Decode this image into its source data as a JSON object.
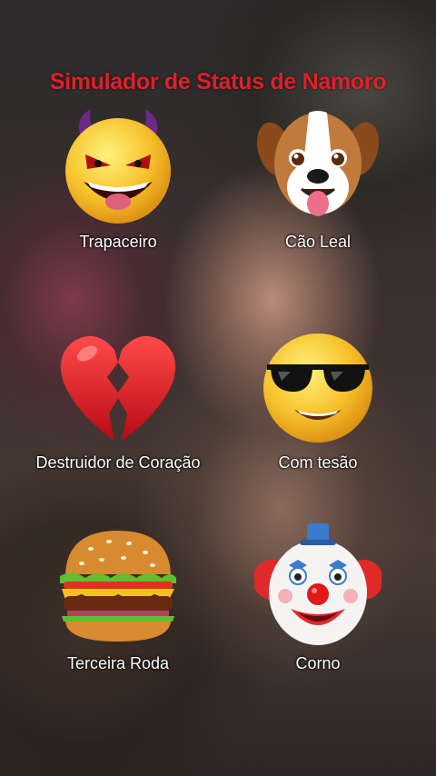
{
  "title": "Simulador de Status de Namoro",
  "items": [
    {
      "label": "Trapaceiro",
      "icon": "smiling-devil-icon"
    },
    {
      "label": "Cão Leal",
      "icon": "dog-face-icon"
    },
    {
      "label": "Destruidor de Coração",
      "icon": "broken-heart-icon"
    },
    {
      "label": "Com tesão",
      "icon": "sunglasses-face-icon"
    },
    {
      "label": "Terceira Roda",
      "icon": "hamburger-icon"
    },
    {
      "label": "Corno",
      "icon": "clown-face-icon"
    }
  ],
  "colors": {
    "title": "#e0202a",
    "label": "#ffffff"
  }
}
